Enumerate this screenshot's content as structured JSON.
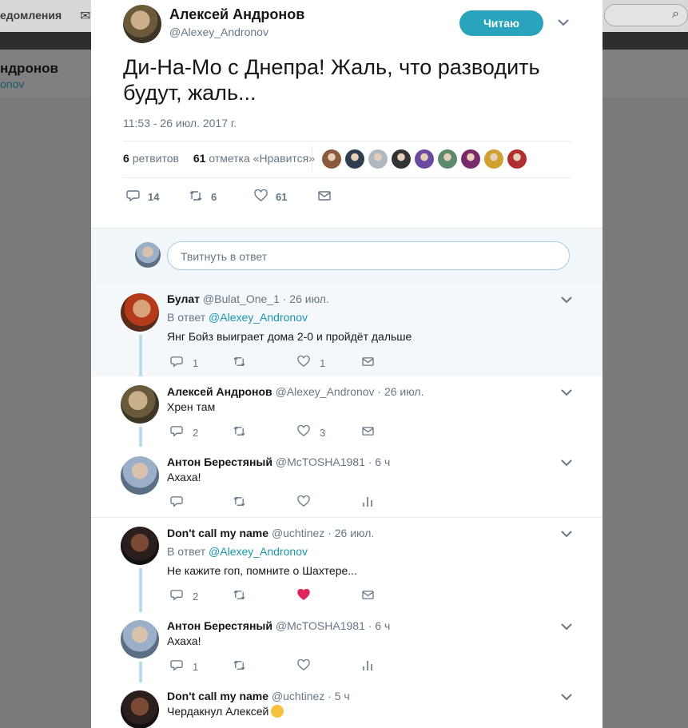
{
  "background": {
    "topbar_text": "едомления",
    "profile_name": "ндронов",
    "profile_handle": "onov"
  },
  "tweet": {
    "author_name": "Алексей Андронов",
    "author_handle": "@Alexey_Andronov",
    "follow_label": "Читаю",
    "text": "Ди-На-Мо с Днепра! Жаль, что разводить будут, жаль...",
    "timestamp": "11:53 - 26 июл. 2017 г.",
    "retweets_count": "6",
    "retweets_label": "ретвитов",
    "likes_count": "61",
    "likes_label": "отметка «Нравится»",
    "liker_colors": [
      "#8a5a3a",
      "#2c3e50",
      "#b0b8c0",
      "#333333",
      "#6a4aa0",
      "#5a8a6a",
      "#7a2a6a",
      "#d0a030",
      "#b03030"
    ],
    "actions": {
      "replies": "14",
      "retweets": "6",
      "likes": "61"
    }
  },
  "reply_box": {
    "placeholder": "Твитнуть в ответ"
  },
  "replies": [
    {
      "name": "Булат",
      "handle": "@Bulat_One_1",
      "time": "· 26 июл.",
      "to_prefix": "В ответ",
      "to_handle": "@Alexey_Andronov",
      "text": "Янг Бойз выиграет дома 2-0 и пройдёт дальше",
      "replies": "1",
      "retweets": "",
      "likes": "1"
    },
    {
      "name": "Алексей Андронов",
      "handle": "@Alexey_Andronov",
      "time": "· 26 июл.",
      "text": "Хрен там",
      "replies": "2",
      "retweets": "",
      "likes": "3"
    },
    {
      "name": "Антон Берестяный",
      "handle": "@McTOSHA1981",
      "time": "· 6 ч",
      "text": "Ахаха!",
      "replies": "",
      "retweets": "",
      "likes": ""
    },
    {
      "name": "Don't call my name",
      "handle": "@uchtinez",
      "time": "· 26 июл.",
      "to_prefix": "В ответ",
      "to_handle": "@Alexey_Andronov",
      "text": "Не кажите гоп, помните о Шахтере...",
      "replies": "2",
      "retweets": "",
      "likes": ""
    },
    {
      "name": "Антон Берестяный",
      "handle": "@McTOSHA1981",
      "time": "· 6 ч",
      "text": "Ахаха!",
      "replies": "1",
      "retweets": "",
      "likes": ""
    },
    {
      "name": "Don't call my name",
      "handle": "@uchtinez",
      "time": "· 5 ч",
      "text": "Чердакнул Алексей",
      "replies": "",
      "retweets": "",
      "likes": ""
    }
  ],
  "colors": {
    "accent": "#2aa3bd",
    "link": "#1b95b0",
    "liked_heart": "#e0245e",
    "thread_line": "#b7dfee"
  }
}
